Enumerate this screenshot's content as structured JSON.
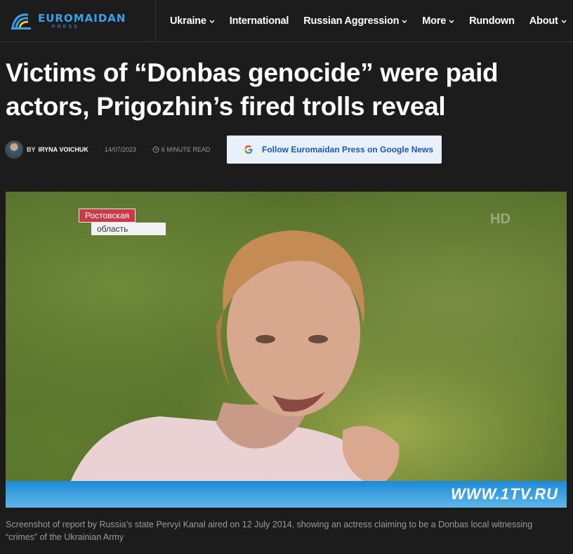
{
  "header": {
    "logo": {
      "name": "EUROMAIDAN",
      "sub": "PRESS"
    },
    "nav": [
      {
        "label": "Ukraine",
        "dropdown": true
      },
      {
        "label": "International",
        "dropdown": false
      },
      {
        "label": "Russian Aggression",
        "dropdown": true
      },
      {
        "label": "More",
        "dropdown": true
      },
      {
        "label": "Rundown",
        "dropdown": false
      },
      {
        "label": "About",
        "dropdown": true
      }
    ]
  },
  "article": {
    "title": "Victims of “Donbas genocide” were paid actors, Prigozhin’s fired trolls reveal",
    "by": "BY",
    "author": "IRYNA VOICHUK",
    "date": "14/07/2023",
    "read_time": "6 MINUTE READ",
    "google_news_label": "Follow Euromaidan Press on Google News"
  },
  "photo": {
    "overlay_region": "Ростовская",
    "overlay_region_sub": "область",
    "channel_hd": "HD",
    "channel_url": "WWW.1TV.RU",
    "caption": "Screenshot of report by Russia’s state Pervyi Kanal aired on 12 July 2014, showing an actress claiming to be a Donbas local witnessing “crimes” of the Ukrainian Army"
  },
  "colors": {
    "background": "#1c1c1c",
    "brand": "#3ba0e6",
    "google_button_bg": "#e8f0fa",
    "google_button_text": "#1a56b8"
  }
}
